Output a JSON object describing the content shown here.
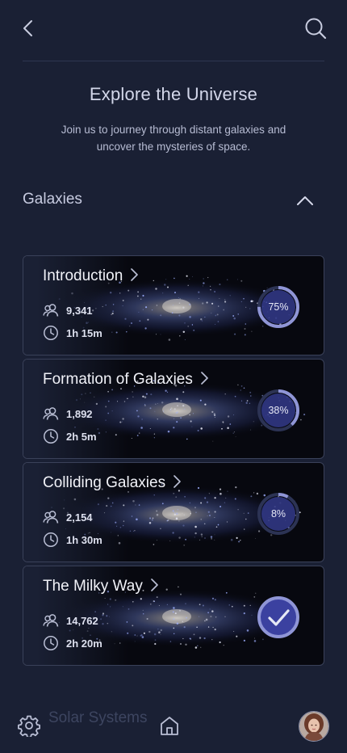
{
  "header": {
    "back_icon": "chevron-left-icon",
    "search_icon": "search-icon"
  },
  "intro": {
    "title": "Explore the Universe",
    "subtitle": "Join us to journey through distant galaxies and uncover the mysteries of space."
  },
  "section": {
    "label": "Galaxies",
    "collapse_icon": "chevron-up-icon"
  },
  "courses": [
    {
      "title": "Introduction",
      "learners": "9,341",
      "duration": "1h 15m",
      "progress_label": "75%",
      "progress": 0.75,
      "completed": false
    },
    {
      "title": "Formation of Galaxies",
      "learners": "1,892",
      "duration": "2h 5m",
      "progress_label": "38%",
      "progress": 0.38,
      "completed": false
    },
    {
      "title": "Colliding Galaxies",
      "learners": "2,154",
      "duration": "1h 30m",
      "progress_label": "8%",
      "progress": 0.08,
      "completed": false
    },
    {
      "title": "The Milky Way",
      "learners": "14,762",
      "duration": "2h 20m",
      "progress_label": "",
      "progress": 1.0,
      "completed": true
    }
  ],
  "next_section_peek": "Solar Systems",
  "bottom_nav": {
    "settings_icon": "gear-icon",
    "home_icon": "home-icon",
    "avatar_icon": "user-avatar"
  },
  "colors": {
    "background": "#1a2034",
    "ring_track": "#2c3354",
    "ring_fill": "#8f95d6",
    "ring_inner": "#333a8a",
    "check_fill": "#3b41a0"
  }
}
